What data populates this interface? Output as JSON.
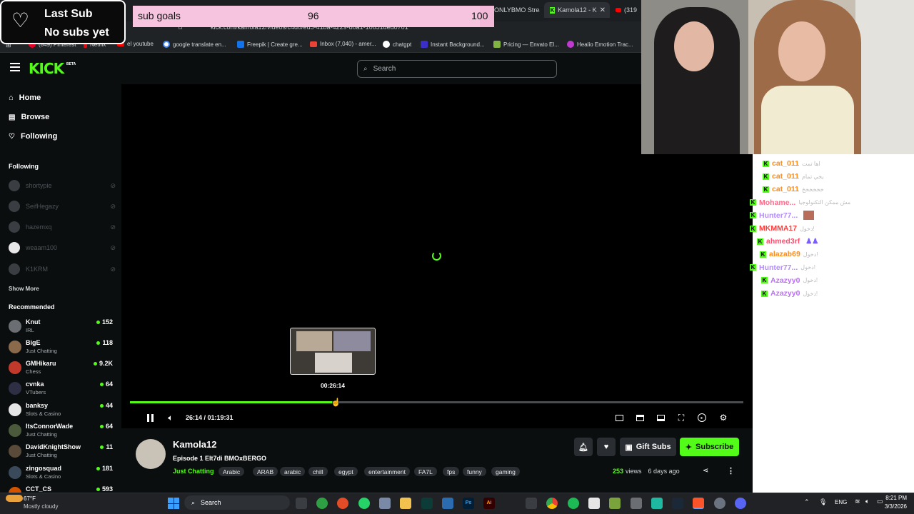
{
  "browser": {
    "tabs": [
      {
        "label": "ONLYBMO Stream",
        "active": false
      },
      {
        "label": "Kamola12 - K",
        "active": true
      },
      {
        "label": "(319",
        "active": false
      }
    ],
    "url": "kick.com/kamola12/videos/c4d0/ed5-41ba-4229-80a1-10651ded0701",
    "bookmarks": [
      {
        "label": "(849) Pinterest",
        "color": "#e60023"
      },
      {
        "label": "Netflix",
        "color": "#e50914"
      },
      {
        "label": "el youtube",
        "color": "#ff0000"
      },
      {
        "label": "google translate en...",
        "color": "#4285f4"
      },
      {
        "label": "Freepik | Create gre...",
        "color": "#1273eb"
      },
      {
        "label": "Inbox (7,040) - amer...",
        "color": "#ea4335"
      },
      {
        "label": "chatgpt",
        "color": "#ffffff"
      },
      {
        "label": "Instant Background...",
        "color": "#3b2fc9"
      },
      {
        "label": "Pricing — Envato El...",
        "color": "#81b441"
      },
      {
        "label": "Healio Emotion Trac...",
        "color": "#c13ad0"
      }
    ]
  },
  "overlay": {
    "last_sub_title": "Last Sub",
    "last_sub_value": "No subs yet",
    "goal_label": "sub goals",
    "goal_current": "96",
    "goal_target": "100",
    "goal_fraction": 0.96
  },
  "header": {
    "logo": "KICK",
    "logo_badge": "BETA",
    "search_placeholder": "Search"
  },
  "sidebar": {
    "nav": [
      {
        "label": "Home",
        "icon": "home-icon"
      },
      {
        "label": "Browse",
        "icon": "browse-icon"
      },
      {
        "label": "Following",
        "icon": "heart-icon"
      }
    ],
    "following_title": "Following",
    "following": [
      "shortypie",
      "SeifHegazy",
      "hazemxq",
      "weaam100",
      "K1KRM"
    ],
    "show_more": "Show More",
    "recommended_title": "Recommended",
    "recommended": [
      {
        "name": "Knut",
        "category": "IRL",
        "viewers": "152",
        "color": "#6b6f73"
      },
      {
        "name": "BigE",
        "category": "Just Chatting",
        "viewers": "118",
        "color": "#8a6a4a"
      },
      {
        "name": "GMHikaru",
        "category": "Chess",
        "viewers": "9.2K",
        "color": "#c0392b"
      },
      {
        "name": "cvnka",
        "category": "VTubers",
        "viewers": "64",
        "color": "#2e2e44"
      },
      {
        "name": "banksy",
        "category": "Slots & Casino",
        "viewers": "44",
        "color": "#e6e6e6"
      },
      {
        "name": "ItsConnorWade",
        "category": "Just Chatting",
        "viewers": "64",
        "color": "#4a5a3a"
      },
      {
        "name": "DavidKnightShow",
        "category": "Just Chatting",
        "viewers": "11",
        "color": "#5a4a3a"
      },
      {
        "name": "zingosquad",
        "category": "Slots & Casino",
        "viewers": "181",
        "color": "#3a4a5a"
      },
      {
        "name": "CCT_CS",
        "category": "",
        "viewers": "593",
        "color": "#d35400"
      }
    ]
  },
  "player": {
    "hover_time": "00:26:14",
    "time_display": "26:14 / 01:19:31",
    "progress": 0.33
  },
  "video_info": {
    "channel": "Kamola12",
    "title": "Episode 1 Elt7di BMOxBERGO",
    "category": "Just Chatting",
    "tags": [
      "Arabic",
      "ARAB",
      "arabic",
      "chill",
      "egypt",
      "entertainment",
      "FA7L",
      "fps",
      "funny",
      "gaming"
    ],
    "views_count": "253",
    "views_label": "views",
    "age": "6 days ago",
    "gift_label": "Gift Subs",
    "subscribe_label": "Subscribe"
  },
  "chat": [
    {
      "user": "cat_011",
      "color": "#ff8c1a",
      "msg": "اها تمت"
    },
    {
      "user": "cat_011",
      "color": "#ff8c1a",
      "msg": "يخي تمام"
    },
    {
      "user": "cat_011",
      "color": "#ff8c1a",
      "msg": "خخخخخخ"
    },
    {
      "user": "Mohame...",
      "color": "#ff6b8a",
      "msg": "مش ممكن التكنولوجيا"
    },
    {
      "user": "Hunter77...",
      "color": "#b58cff",
      "msg": ""
    },
    {
      "user": "MKMMA17",
      "color": "#ff3b3b",
      "msg": "دخول!"
    },
    {
      "user": "ahmed3rf",
      "color": "#ff4d6d",
      "msg": ""
    },
    {
      "user": "alazab69",
      "color": "#ff8c1a",
      "msg": "دخول!"
    },
    {
      "user": "Hunter77...",
      "color": "#b58cff",
      "msg": "دخول!"
    },
    {
      "user": "Azazyy0",
      "color": "#c06bff",
      "msg": "دخول!"
    },
    {
      "user": "Azazyy0",
      "color": "#c06bff",
      "msg": "دخول!"
    }
  ],
  "taskbar": {
    "weather_temp": "67°F",
    "weather_desc": "Mostly cloudy",
    "search_label": "Search",
    "lang": "ENG",
    "time": "8:21 PM",
    "date": "3/3/2026"
  }
}
